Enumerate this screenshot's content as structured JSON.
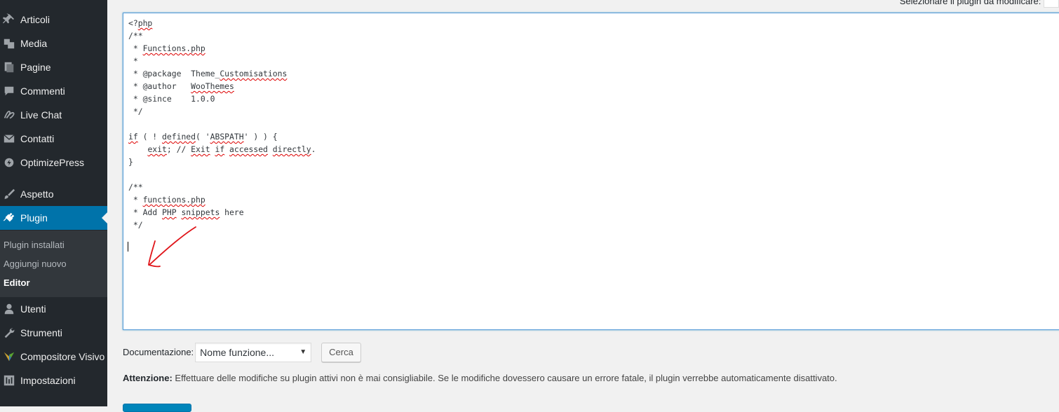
{
  "sidebar": {
    "items": [
      {
        "label": "Articoli",
        "icon": "pushpin-icon"
      },
      {
        "label": "Media",
        "icon": "media-icon"
      },
      {
        "label": "Pagine",
        "icon": "pages-icon"
      },
      {
        "label": "Commenti",
        "icon": "comments-icon"
      },
      {
        "label": "Live Chat",
        "icon": "livechat-icon"
      },
      {
        "label": "Contatti",
        "icon": "envelope-icon"
      },
      {
        "label": "OptimizePress",
        "icon": "optimizepress-icon"
      },
      {
        "label": "Aspetto",
        "icon": "paintbrush-icon"
      },
      {
        "label": "Plugin",
        "icon": "plugin-icon",
        "active": true
      },
      {
        "label": "Utenti",
        "icon": "users-icon"
      },
      {
        "label": "Strumenti",
        "icon": "wrench-icon"
      },
      {
        "label": "Compositore Visivo",
        "icon": "visual-composer-icon"
      },
      {
        "label": "Impostazioni",
        "icon": "settings-icon"
      }
    ],
    "submenu": [
      {
        "label": "Plugin installati"
      },
      {
        "label": "Aggiungi nuovo"
      },
      {
        "label": "Editor",
        "current": true
      }
    ]
  },
  "top": {
    "select_plugin_label": "Selezionare il plugin da modificare:"
  },
  "editor": {
    "code_lines": [
      "<?php",
      "/**",
      " * Functions.php",
      " *",
      " * @package  Theme_Customisations",
      " * @author   WooThemes",
      " * @since    1.0.0",
      " */",
      "",
      "if ( ! defined( 'ABSPATH' ) ) {",
      "    exit; // Exit if accessed directly.",
      "}",
      "",
      "/**",
      " * functions.php",
      " * Add PHP snippets here",
      " */"
    ]
  },
  "documentation": {
    "label": "Documentazione:",
    "select_value": "Nome funzione...",
    "button": "Cerca"
  },
  "warning": {
    "bold": "Attenzione:",
    "text": " Effettuare delle modifiche su plugin attivi non è mai consigliabile. Se le modifiche dovessero causare un errore fatale, il plugin verrebbe automaticamente disattivato."
  },
  "colors": {
    "sidebar_bg": "#23282d",
    "active_bg": "#0073aa",
    "submenu_bg": "#32373c",
    "annotation": "#e0161b"
  }
}
